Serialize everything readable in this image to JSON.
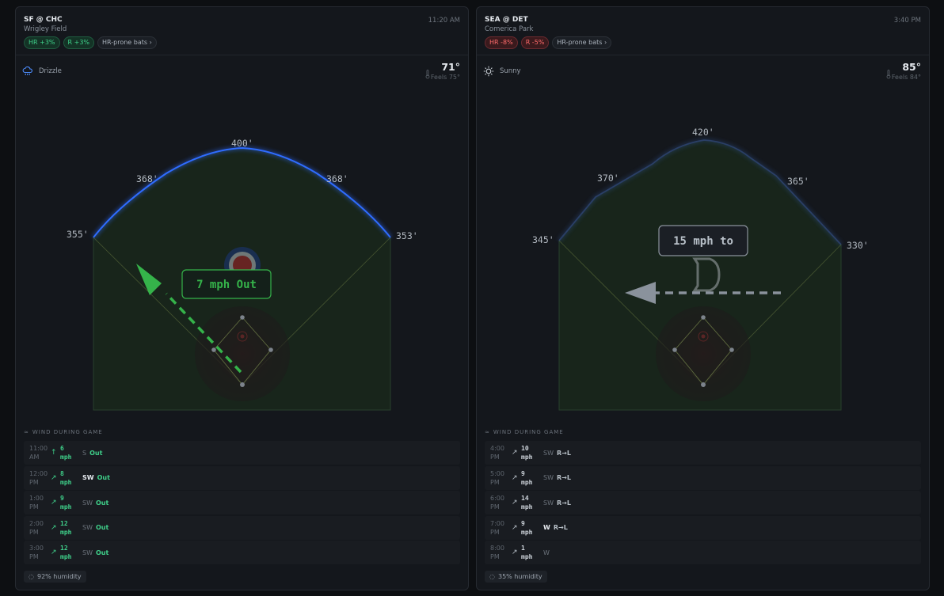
{
  "games": [
    {
      "matchup": "SF @ CHC",
      "park": "Wrigley Field",
      "time": "11:20 AM",
      "badges": [
        "HR +3%",
        "R +3%",
        "HR-prone bats ›"
      ],
      "weather": {
        "icon": "drizzle-icon",
        "label": "Drizzle",
        "temp": "71°",
        "feels": "Feels 75°"
      },
      "field": {
        "distances": {
          "lf_line": "355'",
          "lcf": "368'",
          "cf": "400'",
          "rcf": "368'",
          "rf_line": "353'"
        },
        "wind_label": "7 mph Out",
        "logo": "cubs-logo"
      },
      "wind_title": "WIND DURING GAME",
      "wind": [
        {
          "time_a": "11:00",
          "time_b": "AM",
          "speed": "6",
          "unit": "mph",
          "dir": "S",
          "effect": "Out"
        },
        {
          "time_a": "12:00",
          "time_b": "PM",
          "speed": "8",
          "unit": "mph",
          "dir": "SW",
          "effect": "Out"
        },
        {
          "time_a": "1:00",
          "time_b": "PM",
          "speed": "9",
          "unit": "mph",
          "dir": "SW",
          "effect": "Out"
        },
        {
          "time_a": "2:00",
          "time_b": "PM",
          "speed": "12",
          "unit": "mph",
          "dir": "SW",
          "effect": "Out"
        },
        {
          "time_a": "3:00",
          "time_b": "PM",
          "speed": "12",
          "unit": "mph",
          "dir": "SW",
          "effect": "Out"
        }
      ],
      "humidity": "92% humidity"
    },
    {
      "matchup": "SEA @ DET",
      "park": "Comerica Park",
      "time": "3:40 PM",
      "badges": [
        "HR -8%",
        "R -5%",
        "HR-prone bats ›"
      ],
      "weather": {
        "icon": "sun-icon",
        "label": "Sunny",
        "temp": "85°",
        "feels": "Feels 84°"
      },
      "field": {
        "distances": {
          "lf_line": "345'",
          "lcf": "370'",
          "cf": "420'",
          "rcf": "365'",
          "rf_line": "330'"
        },
        "wind_label": "15 mph to",
        "logo": "tigers-logo"
      },
      "wind_title": "WIND DURING GAME",
      "wind": [
        {
          "time_a": "4:00",
          "time_b": "PM",
          "speed": "10",
          "unit": "mph",
          "dir": "SW",
          "effect": "R→L"
        },
        {
          "time_a": "5:00",
          "time_b": "PM",
          "speed": "9",
          "unit": "mph",
          "dir": "SW",
          "effect": "R→L"
        },
        {
          "time_a": "6:00",
          "time_b": "PM",
          "speed": "14",
          "unit": "mph",
          "dir": "SW",
          "effect": "R→L"
        },
        {
          "time_a": "7:00",
          "time_b": "PM",
          "speed": "9",
          "unit": "mph",
          "dir": "W",
          "effect": "R→L"
        },
        {
          "time_a": "8:00",
          "time_b": "PM",
          "speed": "1",
          "unit": "mph",
          "dir": "W",
          "effect": ""
        }
      ],
      "humidity": "35% humidity"
    }
  ],
  "colors": {
    "accent_good": "#3fd08a",
    "accent_bad": "#ff6b6b",
    "wall_chc": "#2f6cff",
    "wind_arrow_chc": "#35b34a",
    "wind_arrow_det": "#8a929c"
  }
}
